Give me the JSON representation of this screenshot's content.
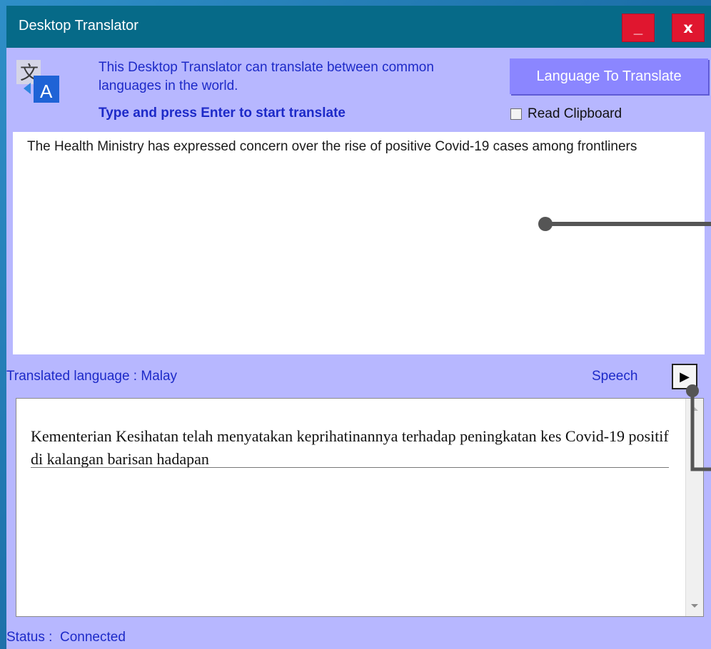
{
  "window": {
    "title": "Desktop Translator",
    "minimize_label": "_",
    "close_label": "x"
  },
  "header": {
    "icon": "translate-icon",
    "description": "This Desktop Translator can translate between common languages in the world.",
    "instruction": "Type and press Enter to start translate",
    "language_button": "Language To Translate",
    "read_clipboard_label": "Read Clipboard",
    "read_clipboard_checked": false
  },
  "input": {
    "text": "The Health Ministry has expressed concern over the rise of positive Covid-19 cases among frontliners"
  },
  "translation": {
    "label": "Translated language : Malay",
    "speech_label": "Speech",
    "play_icon": "play-icon",
    "text": "Kementerian Kesihatan telah menyatakan keprihatinannya terhadap peningkatan kes Covid-19 positif di kalangan barisan hadapan"
  },
  "status": {
    "text": "Status :  Connected"
  },
  "colors": {
    "titlebar": "#066a88",
    "window_bg": "#b7b7ff",
    "accent_text": "#1d2ac8",
    "button": "#8b86ff",
    "close": "#e0162f"
  }
}
